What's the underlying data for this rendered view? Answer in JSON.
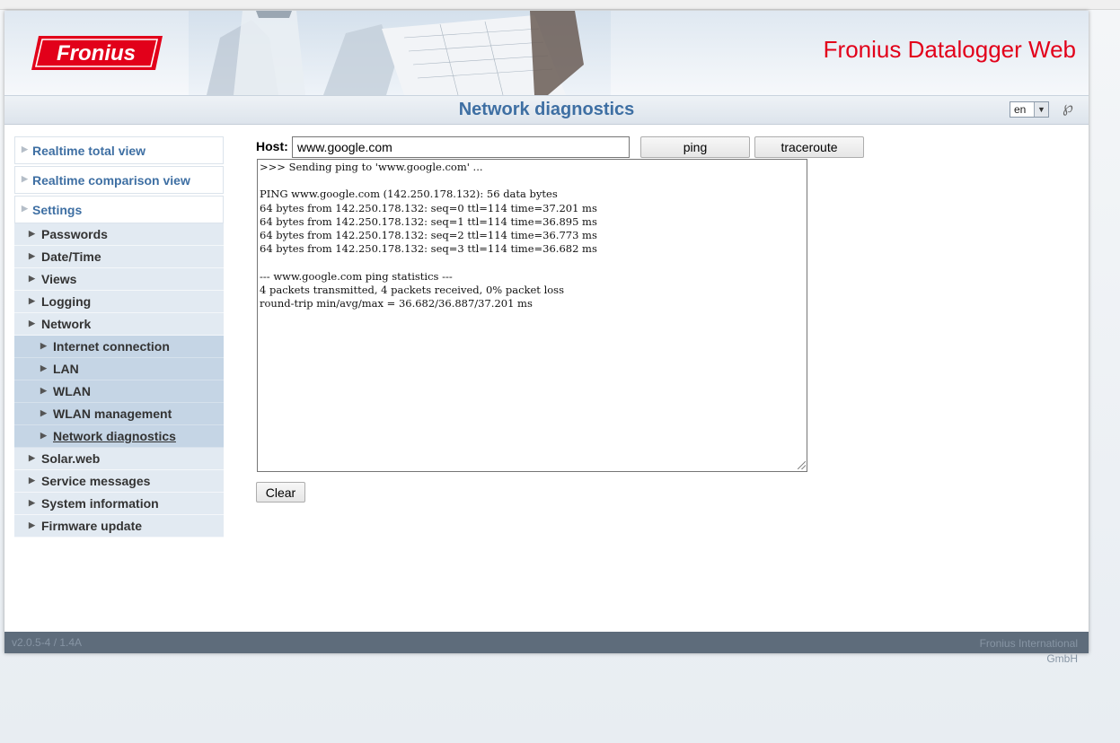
{
  "header": {
    "logo_text": "Fronius",
    "app_title": "Fronius Datalogger Web"
  },
  "titlebar": {
    "page_title": "Network diagnostics",
    "language": "en",
    "help_icon": "help-icon"
  },
  "sidebar": {
    "main": [
      {
        "label": "Realtime total view"
      },
      {
        "label": "Realtime comparison view"
      },
      {
        "label": "Settings"
      }
    ],
    "settings_items_before": [
      {
        "label": "Passwords"
      },
      {
        "label": "Date/Time"
      },
      {
        "label": "Views"
      },
      {
        "label": "Logging"
      },
      {
        "label": "Network"
      }
    ],
    "network_items": [
      {
        "label": "Internet connection"
      },
      {
        "label": "LAN"
      },
      {
        "label": "WLAN"
      },
      {
        "label": "WLAN management"
      },
      {
        "label": "Network diagnostics",
        "active": true
      }
    ],
    "settings_items_after": [
      {
        "label": "Solar.web"
      },
      {
        "label": "Service messages"
      },
      {
        "label": "System information"
      },
      {
        "label": "Firmware update"
      }
    ]
  },
  "main": {
    "host_label": "Host:",
    "host_value": "www.google.com",
    "ping_label": "ping",
    "traceroute_label": "traceroute",
    "output": ">>> Sending ping to 'www.google.com' ...\n\nPING www.google.com (142.250.178.132): 56 data bytes\n64 bytes from 142.250.178.132: seq=0 ttl=114 time=37.201 ms\n64 bytes from 142.250.178.132: seq=1 ttl=114 time=36.895 ms\n64 bytes from 142.250.178.132: seq=2 ttl=114 time=36.773 ms\n64 bytes from 142.250.178.132: seq=3 ttl=114 time=36.682 ms\n\n--- www.google.com ping statistics ---\n4 packets transmitted, 4 packets received, 0% packet loss\nround-trip min/avg/max = 36.682/36.887/37.201 ms",
    "clear_label": "Clear"
  },
  "footer": {
    "version": "v2.0.5-4 / 1.4A",
    "company": "Fronius International GmbH"
  },
  "colors": {
    "brand_red": "#e2001a",
    "title_blue": "#3e6fa3",
    "footer_bg": "#5e6c7b"
  }
}
